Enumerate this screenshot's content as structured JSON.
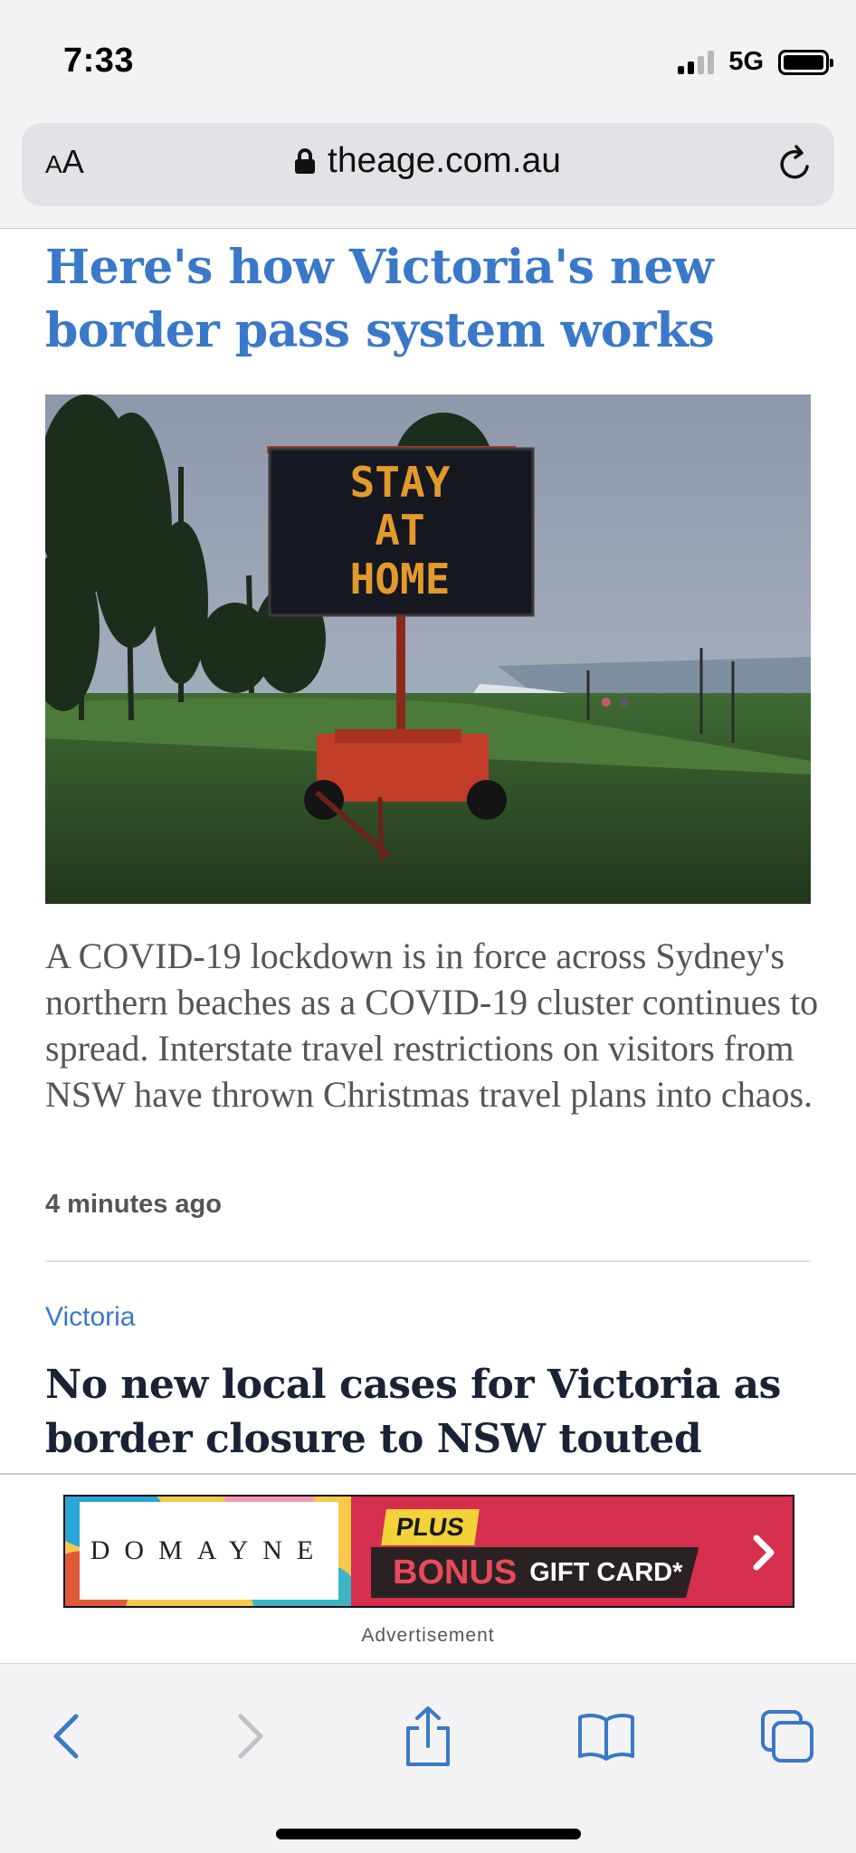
{
  "status_bar": {
    "time": "7:33",
    "network": "5G"
  },
  "browser": {
    "text_size_label_small": "A",
    "text_size_label_large": "A",
    "url": "theage.com.au"
  },
  "articles": [
    {
      "headline": "Here's how Victoria's new border pass system works",
      "image_sign_text": [
        "STAY",
        "AT",
        "HOME"
      ],
      "summary": "A COVID-19 lockdown is in force across Sydney's northern beaches as a COVID-19 cluster continues to spread. Interstate travel restrictions on visitors from NSW have thrown Christmas travel plans into chaos.",
      "timestamp": "4 minutes ago"
    },
    {
      "section": "Victoria",
      "headline": "No new local cases for Victoria as border closure to NSW touted"
    }
  ],
  "ad": {
    "brand": "DOMAYNE",
    "plus": "PLUS",
    "bonus": "BONUS",
    "gift_card": "GIFT CARD*",
    "caption": "Advertisement"
  },
  "colors": {
    "link_blue": "#3a78c9",
    "toolbar_blue": "#3a78c9",
    "ad_red": "#d62e4f"
  }
}
